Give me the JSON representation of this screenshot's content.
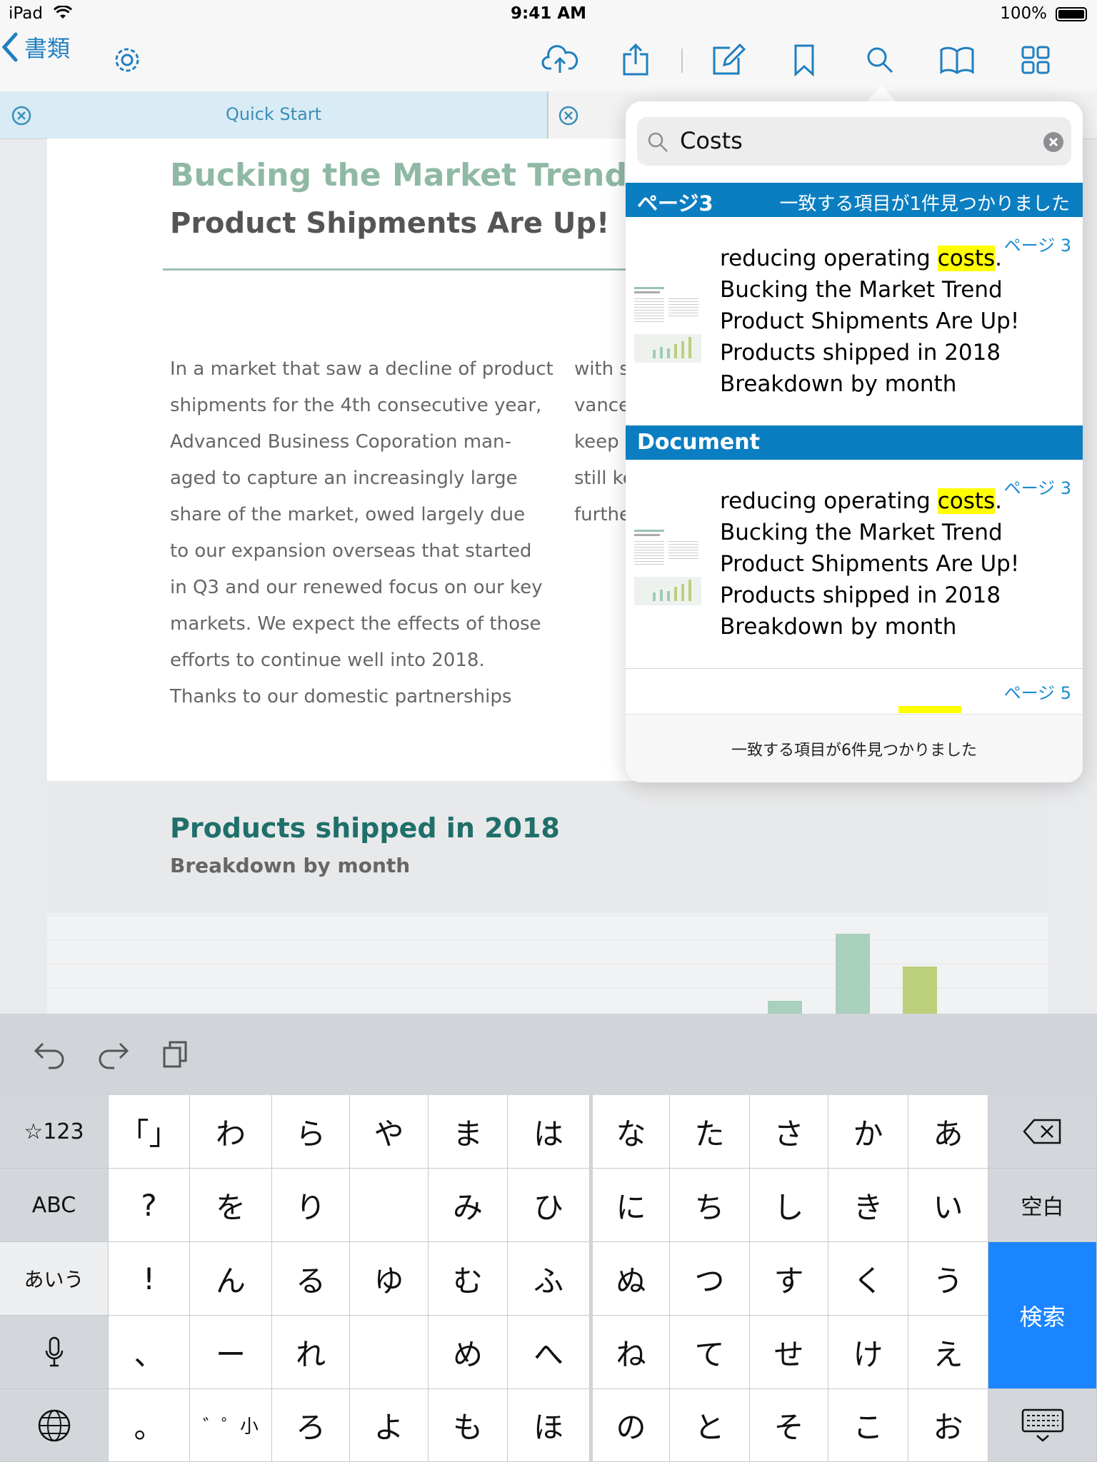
{
  "status": {
    "device": "iPad",
    "time": "9:41 AM",
    "battery": "100%"
  },
  "nav": {
    "back_label": "書類",
    "icons": [
      "back-chevron-icon",
      "gear-icon",
      "cloud-upload-icon",
      "share-icon",
      "edit-icon",
      "bookmark-icon",
      "search-icon",
      "book-icon",
      "grid-icon"
    ]
  },
  "tabs": [
    {
      "label": "Quick Start"
    }
  ],
  "document": {
    "title": "Bucking the Market Trend",
    "subtitle": "Product Shipments Are Up!",
    "body_lines": [
      "In a market that saw a decline of product",
      "shipments for the 4th consecutive year,",
      "Advanced Business Coporation man-",
      "aged to capture an increasingly large",
      "share of the market, owed largely due",
      "to our expansion overseas that started",
      "in Q3 and our renewed focus on our key",
      "markets. We expect the effects of those",
      "efforts to continue well into 2018.",
      "Thanks to our domestic partnerships"
    ],
    "col2_lines": [
      "with s",
      "vance",
      "keep u",
      "still ke",
      "furthe"
    ],
    "section_title": "Products shipped in 2018",
    "section_subtitle": "Breakdown by month",
    "colors": {
      "title": "#8fb9a4",
      "heading": "#1f6f6a",
      "bar_green": "#a9cfbd",
      "bar_lime": "#bccf7a"
    }
  },
  "search": {
    "query": "Costs",
    "section1": {
      "page": "ページ3",
      "count_text": "一致する項目が1件見つかりました"
    },
    "section2": {
      "label": "Document"
    },
    "results": [
      {
        "page": "ページ 3",
        "before": "reducing operating ",
        "match": "costs",
        "after": ".",
        "lines": [
          "Bucking the Market Trend",
          "Product Shipments Are Up!",
          "Products shipped in 2018",
          "Breakdown by month"
        ]
      },
      {
        "page": "ページ 3",
        "before": "reducing operating ",
        "match": "costs",
        "after": ".",
        "lines": [
          "Bucking the Market Trend",
          "Product Shipments Are Up!",
          "Products shipped in 2018",
          "Breakdown by month"
        ]
      },
      {
        "page": "ページ 5"
      }
    ],
    "footer": "一致する項目が6件見つかりました"
  },
  "keyboard": {
    "toolbar_icons": [
      "undo-icon",
      "redo-icon",
      "paste-icon"
    ],
    "left_keys": [
      "☆123",
      "ABC",
      "あいう",
      "mic",
      "globe"
    ],
    "punct_keys": [
      "「」",
      "?",
      "!",
      "、",
      "。"
    ],
    "rows": [
      [
        "わ",
        "ら",
        "や",
        "ま",
        "は",
        "な",
        "た",
        "さ",
        "か",
        "あ"
      ],
      [
        "を",
        "り",
        "",
        "み",
        "ひ",
        "に",
        "ち",
        "し",
        "き",
        "い"
      ],
      [
        "ん",
        "る",
        "ゆ",
        "む",
        "ふ",
        "ぬ",
        "つ",
        "す",
        "く",
        "う"
      ],
      [
        "ー",
        "れ",
        "",
        "め",
        "へ",
        "ね",
        "て",
        "せ",
        "け",
        "え"
      ],
      [
        "゛゜小",
        "ろ",
        "よ",
        "も",
        "ほ",
        "の",
        "と",
        "そ",
        "こ",
        "お"
      ]
    ],
    "space_label": "空白",
    "search_label": "検索"
  }
}
